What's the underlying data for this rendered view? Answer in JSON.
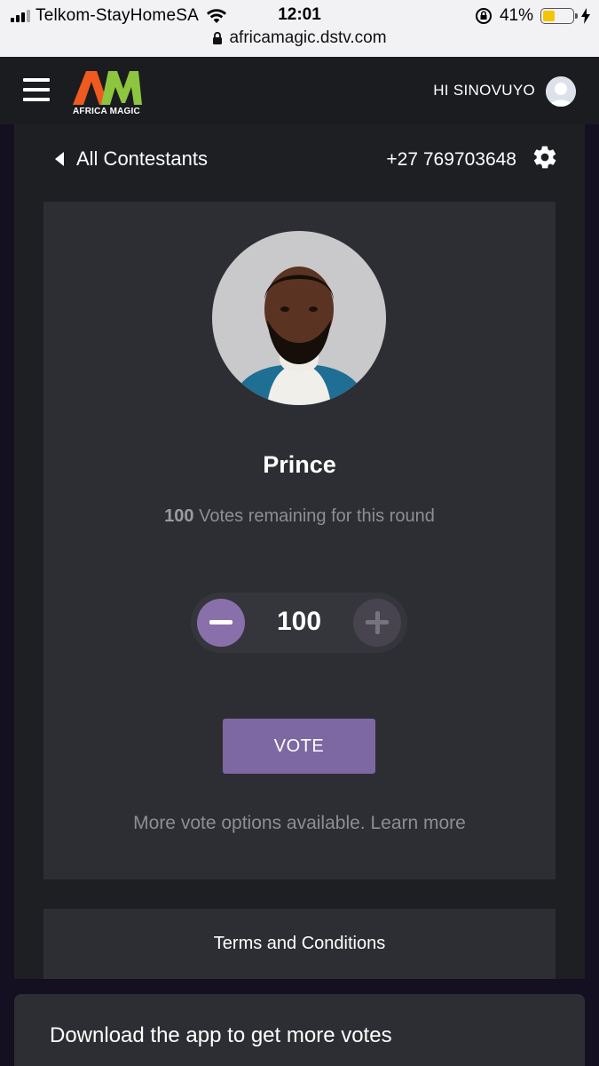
{
  "status_bar": {
    "carrier": "Telkom-StayHomeSA",
    "time": "12:01",
    "battery_percent": "41%",
    "battery_level": 0.41,
    "url": "africamagic.dstv.com",
    "icons": [
      "signal-icon",
      "wifi-icon",
      "rotation-lock-icon",
      "battery-icon",
      "charging-icon",
      "lock-icon"
    ]
  },
  "header": {
    "logo_text": "AFRICA MAGIC",
    "greeting": "HI SINOVUYO",
    "colors": {
      "logo_orange": "#f05a1e",
      "logo_green": "#8cc63f"
    }
  },
  "nav": {
    "back_label": "All Contestants",
    "phone": "+27 769703648"
  },
  "contestant": {
    "name": "Prince",
    "votes_remaining_count": "100",
    "votes_remaining_text": "Votes remaining for this round"
  },
  "stepper": {
    "value": "100"
  },
  "actions": {
    "vote_label": "VOTE",
    "more_options": "More vote options available. Learn more",
    "terms": "Terms and Conditions",
    "download": "Download the app to get more votes"
  },
  "colors": {
    "accent": "#7e68a3",
    "card_bg": "#2d2e33",
    "page_bg": "#1e1f23"
  }
}
